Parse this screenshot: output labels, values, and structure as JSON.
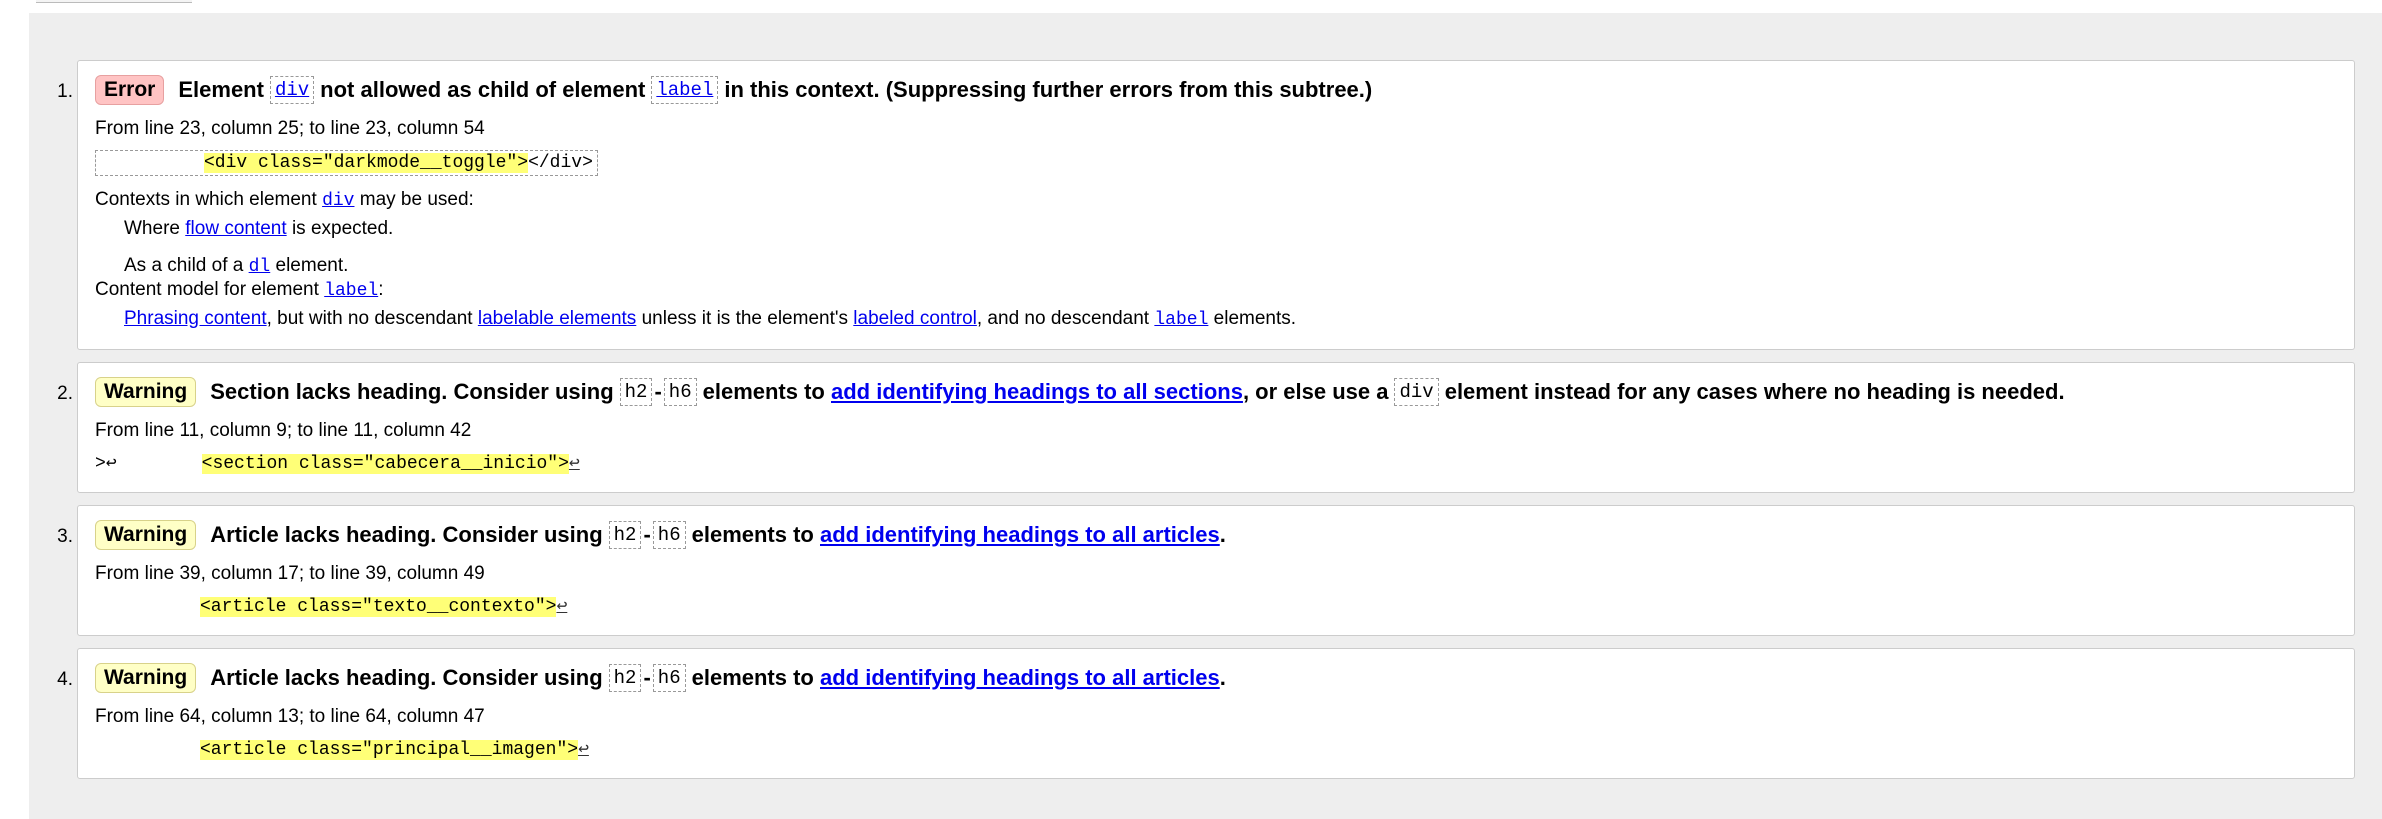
{
  "messages": [
    {
      "index": "1.",
      "type": "Error",
      "heading": {
        "p1": "Element",
        "code1": "div",
        "p2": "not allowed as child of element",
        "code2": "label",
        "p3": "in this context. (Suppressing further errors from this subtree.)"
      },
      "location": "From line 23, column 25; to line 23, column 54",
      "extract": "<div class=\"darkmode__toggle\">",
      "extract_tail": "</div>",
      "contexts_prefix": "Contexts in which element",
      "contexts_code": "div",
      "contexts_suffix": "may be used:",
      "where_prefix": "Where",
      "where_link": "flow content",
      "where_suffix": "is expected.",
      "child_prefix": "As a child of a",
      "child_code": "dl",
      "child_suffix": "element.",
      "model_prefix": "Content model for element",
      "model_code": "label",
      "model_suffix": ":",
      "phrasing_link": "Phrasing content",
      "phrasing_t1": ", but with no descendant",
      "labelable_link": "labelable elements",
      "phrasing_t2": "unless it is the element's",
      "labeled_link": "labeled control",
      "phrasing_t3": ", and no descendant",
      "label_code": "label",
      "phrasing_t4": "elements."
    },
    {
      "index": "2.",
      "type": "Warning",
      "heading": {
        "p1": "Section lacks heading. Consider using",
        "code1": "h2",
        "dash": "-",
        "code2": "h6",
        "p2": "elements to",
        "link": "add identifying headings to all sections",
        "p3": ", or else use a",
        "code3": "div",
        "p4": "element instead for any cases where no heading is needed."
      },
      "location": "From line 11, column 9; to line 11, column 42",
      "extract_lead": ">↩",
      "extract": "<section class=\"cabecera__inicio\">",
      "extract_tail": "↩"
    },
    {
      "index": "3.",
      "type": "Warning",
      "heading": {
        "p1": "Article lacks heading. Consider using",
        "code1": "h2",
        "dash": "-",
        "code2": "h6",
        "p2": "elements to",
        "link": "add identifying headings to all articles",
        "p3": "."
      },
      "location": "From line 39, column 17; to line 39, column 49",
      "extract": "<article class=\"texto__contexto\">",
      "extract_tail": "↩"
    },
    {
      "index": "4.",
      "type": "Warning",
      "heading": {
        "p1": "Article lacks heading. Consider using",
        "code1": "h2",
        "dash": "-",
        "code2": "h6",
        "p2": "elements to",
        "link": "add identifying headings to all articles",
        "p3": "."
      },
      "location": "From line 64, column 13; to line 64, column 47",
      "extract": "<article class=\"principal__imagen\">",
      "extract_tail": "↩"
    }
  ],
  "colors": {
    "error_badge": "#ffc4c4",
    "warning_badge": "#ffffc6",
    "highlight": "#ffff77",
    "link": "#0000ee"
  }
}
